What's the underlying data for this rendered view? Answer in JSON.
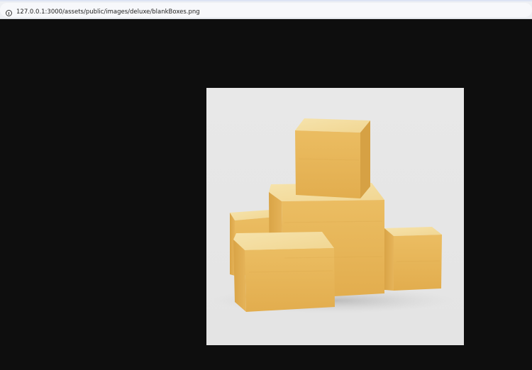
{
  "address_bar": {
    "url": "127.0.0.1:3000/assets/public/images/deluxe/blankBoxes.png",
    "icon": "info-icon"
  },
  "viewer": {
    "background_color": "#0e0e0e",
    "image": {
      "description_icon": "stacked-cardboard-boxes-image",
      "background_color": "#e6e6e6",
      "box_color": "#e6b458"
    }
  }
}
